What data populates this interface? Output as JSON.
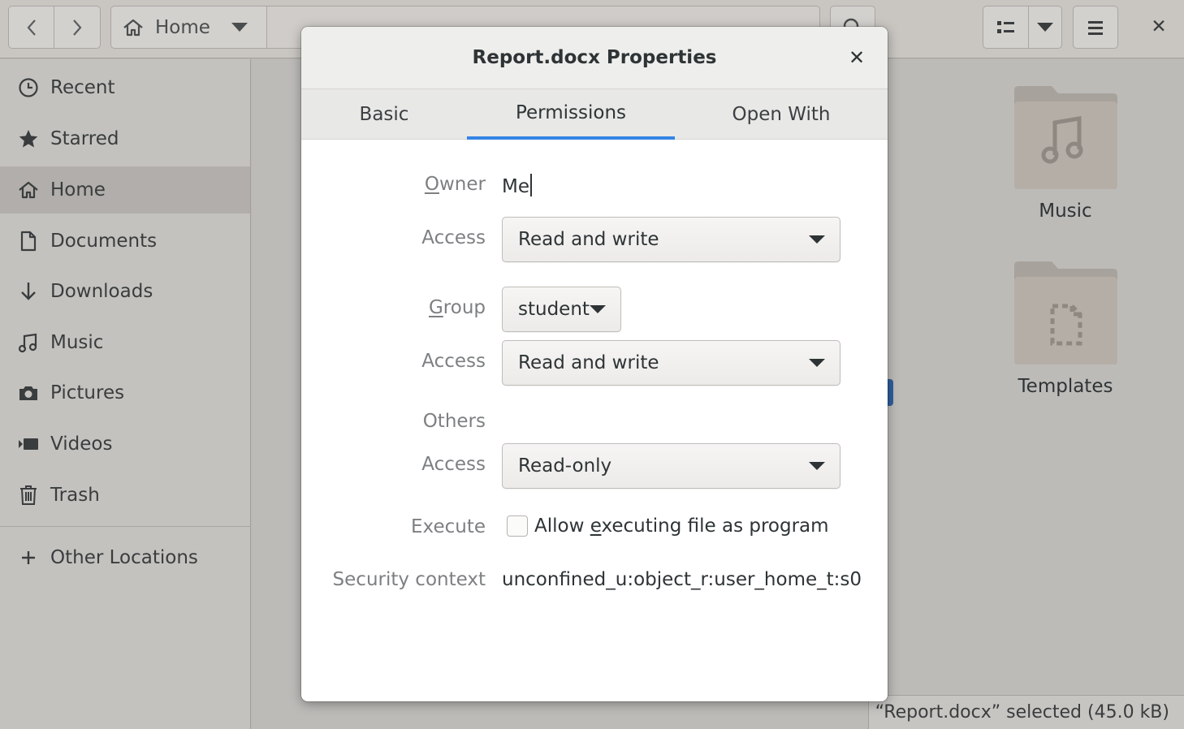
{
  "headerbar": {
    "location": "Home",
    "back_icon": "chevron-left-icon",
    "forward_icon": "chevron-right-icon",
    "home_icon": "home-icon",
    "search_icon": "search-icon",
    "view_icon": "list-view-icon",
    "menu_icon": "hamburger-icon",
    "close_label": "✕"
  },
  "sidebar": {
    "items": [
      {
        "label": "Recent",
        "icon": "clock-icon"
      },
      {
        "label": "Starred",
        "icon": "star-icon"
      },
      {
        "label": "Home",
        "icon": "home-icon",
        "active": true
      },
      {
        "label": "Documents",
        "icon": "document-icon"
      },
      {
        "label": "Downloads",
        "icon": "download-arrow-icon"
      },
      {
        "label": "Music",
        "icon": "music-note-icon"
      },
      {
        "label": "Pictures",
        "icon": "camera-icon"
      },
      {
        "label": "Videos",
        "icon": "video-icon"
      },
      {
        "label": "Trash",
        "icon": "trash-icon"
      }
    ],
    "other_locations": {
      "label": "Other Locations",
      "icon": "plus-icon"
    }
  },
  "content": {
    "files": [
      {
        "name": "Music",
        "icon": "music-folder-icon"
      },
      {
        "name": "Templates",
        "icon": "templates-folder-icon"
      }
    ]
  },
  "statusbar": {
    "text": "“Report.docx” selected  (45.0 kB)"
  },
  "dialog": {
    "title": "Report.docx Properties",
    "close_label": "✕",
    "tabs": [
      {
        "label": "Basic",
        "active": false
      },
      {
        "label": "Permissions",
        "active": true
      },
      {
        "label": "Open With",
        "active": false
      }
    ],
    "owner": {
      "label": "Owner",
      "value": "Me"
    },
    "owner_access": {
      "label": "Access",
      "value": "Read and write"
    },
    "group": {
      "label": "Group",
      "value": "student"
    },
    "group_access": {
      "label": "Access",
      "value": "Read and write"
    },
    "others": {
      "label": "Others"
    },
    "others_access": {
      "label": "Access",
      "value": "Read-only"
    },
    "execute": {
      "label": "Execute",
      "checkbox_label": "Allow executing file as program",
      "checked": false
    },
    "security": {
      "label": "Security context",
      "value": "unconfined_u:object_r:user_home_t:s0"
    }
  },
  "colors": {
    "accent": "#3584e4",
    "dialog_bg": "#ffffff",
    "backdrop": "#bdbbb8"
  }
}
